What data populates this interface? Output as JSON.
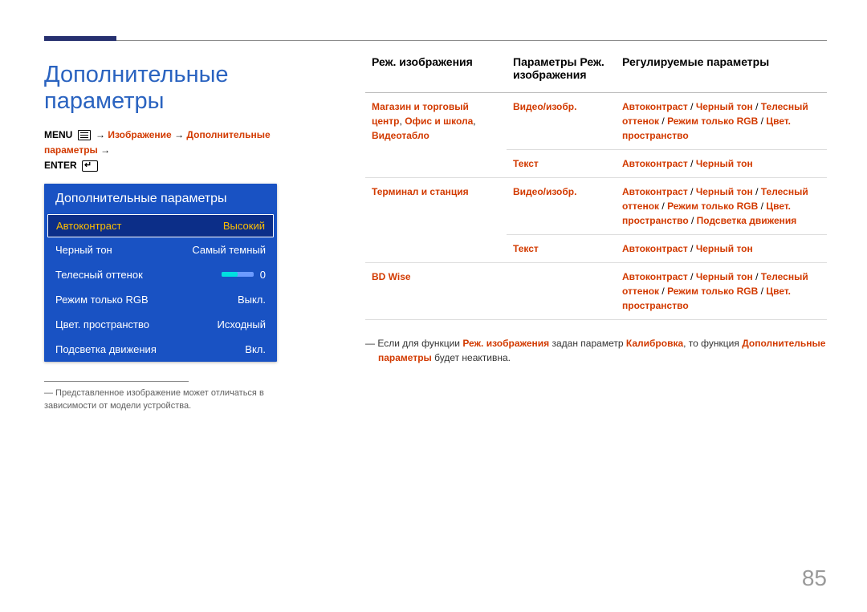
{
  "title": "Дополнительные параметры",
  "breadcrumb": {
    "menu": "MENU",
    "arrow": " → ",
    "p1": "Изображение",
    "p2": "Дополнительные параметры",
    "enter": "ENTER"
  },
  "osd": {
    "title": "Дополнительные параметры",
    "rows": [
      {
        "label": "Автоконтраст",
        "value": "Высокий",
        "sel": true
      },
      {
        "label": "Черный тон",
        "value": "Самый темный"
      },
      {
        "label": "Телесный оттенок",
        "value": "0",
        "slider": true
      },
      {
        "label": "Режим только RGB",
        "value": "Выкл."
      },
      {
        "label": "Цвет. пространство",
        "value": "Исходный"
      },
      {
        "label": "Подсветка движения",
        "value": "Вкл."
      }
    ]
  },
  "footnote": "―  Представленное изображение может отличаться в зависимости от модели устройства.",
  "table": {
    "h1": "Реж. изображения",
    "h2": "Параметры Реж. изображения",
    "h3": "Регулируемые параметры",
    "rows": [
      {
        "c1": [
          "Магазин и торговый центр",
          ", ",
          "Офис и школа",
          ", ",
          "Видеотабло"
        ],
        "span": 2,
        "subs": [
          {
            "c2": "Видео/изобр.",
            "c3": [
              "Автоконтраст",
              " / ",
              "Черный тон",
              " / ",
              "Телесный оттенок",
              " / ",
              "Режим только RGB",
              " / ",
              "Цвет. пространство"
            ]
          },
          {
            "c2": "Текст",
            "c3": [
              "Автоконтраст",
              " / ",
              "Черный тон"
            ]
          }
        ]
      },
      {
        "c1": [
          "Терминал и станция"
        ],
        "span": 2,
        "subs": [
          {
            "c2": "Видео/изобр.",
            "c3": [
              "Автоконтраст",
              " / ",
              "Черный тон",
              " / ",
              "Телесный оттенок",
              " / ",
              "Режим только RGB",
              " / ",
              "Цвет. пространство",
              " / ",
              "Подсветка движения"
            ]
          },
          {
            "c2": "Текст",
            "c3": [
              "Автоконтраст",
              " / ",
              "Черный тон"
            ]
          }
        ]
      },
      {
        "c1": [
          "BD Wise"
        ],
        "span": 1,
        "subs": [
          {
            "c2": "",
            "c3": [
              "Автоконтраст",
              " / ",
              "Черный тон",
              " / ",
              "Телесный оттенок",
              " / ",
              "Режим только RGB",
              " / ",
              "Цвет. пространство"
            ]
          }
        ]
      }
    ]
  },
  "note": {
    "pre": "―  Если для функции ",
    "hl1": "Реж. изображения",
    "mid1": " задан параметр ",
    "hl2": "Калибровка",
    "mid2": ", то функция ",
    "hl3": "Дополнительные параметры",
    "post": " будет неактивна."
  },
  "pagenum": "85"
}
